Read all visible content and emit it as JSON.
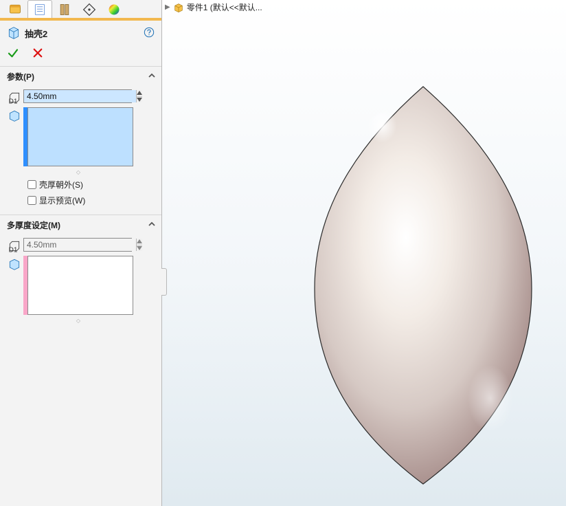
{
  "breadcrumb": {
    "part_label": "零件1  (默认<<默认..."
  },
  "feature": {
    "name": "抽壳2"
  },
  "params": {
    "header": "参数(P)",
    "thickness_value": "4.50mm",
    "chk_shell_outward": "壳厚朝外(S)",
    "chk_show_preview": "显示预览(W)"
  },
  "multi": {
    "header": "多厚度设定(M)",
    "thickness_value": "4.50mm"
  }
}
